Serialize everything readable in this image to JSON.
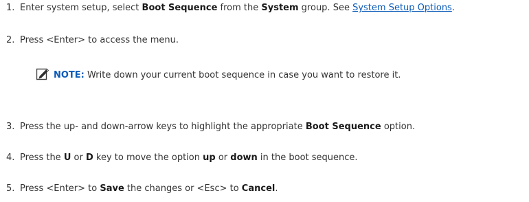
{
  "steps": [
    {
      "number": "1.",
      "t1": "Enter system setup, select ",
      "b1": "Boot Sequence",
      "t2": " from the ",
      "b2": "System",
      "t3": " group. See ",
      "link": "System Setup Options",
      "t4": "."
    },
    {
      "number": "2.",
      "t1": "Press <Enter> to access the menu."
    },
    {
      "number": "3.",
      "t1": "Press the up- and down-arrow keys to highlight the appropriate ",
      "b1": "Boot Sequence",
      "t2": " option."
    },
    {
      "number": "4.",
      "t1": "Press the ",
      "b1": "U",
      "t2": " or ",
      "b2": "D",
      "t3": " key to move the option ",
      "b3": "up",
      "t4": " or ",
      "b4": "down",
      "t5": " in the boot sequence."
    },
    {
      "number": "5.",
      "t1": "Press <Enter> to ",
      "b1": "Save",
      "t2": " the changes or <Esc> to ",
      "b2": "Cancel",
      "t3": "."
    }
  ],
  "note": {
    "icon": "pencil-note-icon",
    "label": "NOTE:",
    "text": " Write down your current boot sequence in case you want to restore it."
  }
}
